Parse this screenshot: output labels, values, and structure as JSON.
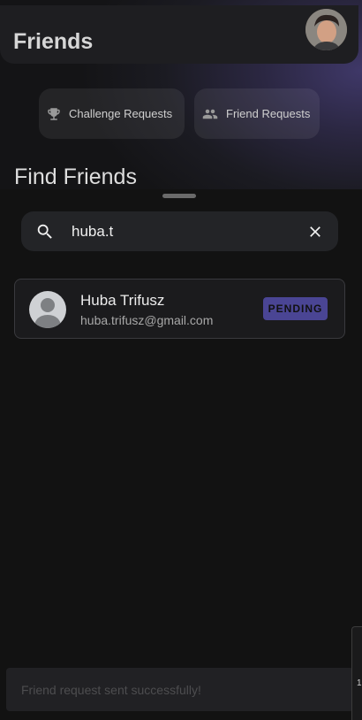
{
  "header": {
    "title": "Friends"
  },
  "quick_actions": {
    "challenge_requests": "Challenge Requests",
    "friend_requests": "Friend Requests"
  },
  "find": {
    "title": "Find Friends"
  },
  "search": {
    "value": "huba.t",
    "placeholder": ""
  },
  "results": [
    {
      "name": "Huba Trifusz",
      "email": "huba.trifusz@gmail.com",
      "status": "PENDING"
    }
  ],
  "snackbar": {
    "message": "Friend request sent successfully!"
  },
  "edge_popup": {
    "glyphs": [
      "1"
    ]
  },
  "colors": {
    "background": "#121212",
    "accent": "#4a4594",
    "card": "#1b1b1d"
  }
}
